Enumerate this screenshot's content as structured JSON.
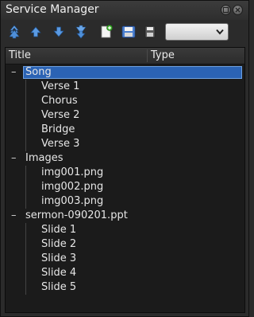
{
  "window": {
    "title": "Service Manager"
  },
  "toolbar": {
    "buttons": [
      {
        "name": "move-to-top-icon"
      },
      {
        "name": "move-up-icon"
      },
      {
        "name": "move-down-icon"
      },
      {
        "name": "move-to-bottom-icon"
      },
      {
        "name": "new-service-icon"
      },
      {
        "name": "save-service-icon"
      },
      {
        "name": "save-as-icon"
      }
    ],
    "theme_select_value": ""
  },
  "list": {
    "columns": {
      "title": "Title",
      "type": "Type"
    },
    "items": [
      {
        "toggle": "–",
        "label": "Song",
        "children": [
          "Verse 1",
          "Chorus",
          "Verse 2",
          "Bridge",
          "Verse 3"
        ]
      },
      {
        "toggle": "–",
        "label": "Images",
        "children": [
          "img001.png",
          "img002.png",
          "img003.png"
        ]
      },
      {
        "toggle": "–",
        "label": "sermon-090201.ppt",
        "children": [
          "Slide 1",
          "Slide 2",
          "Slide 3",
          "Slide 4",
          "Slide 5"
        ]
      }
    ]
  },
  "colors": {
    "selection": "#2b63b4",
    "panel_bg": "#1b1b1b"
  }
}
